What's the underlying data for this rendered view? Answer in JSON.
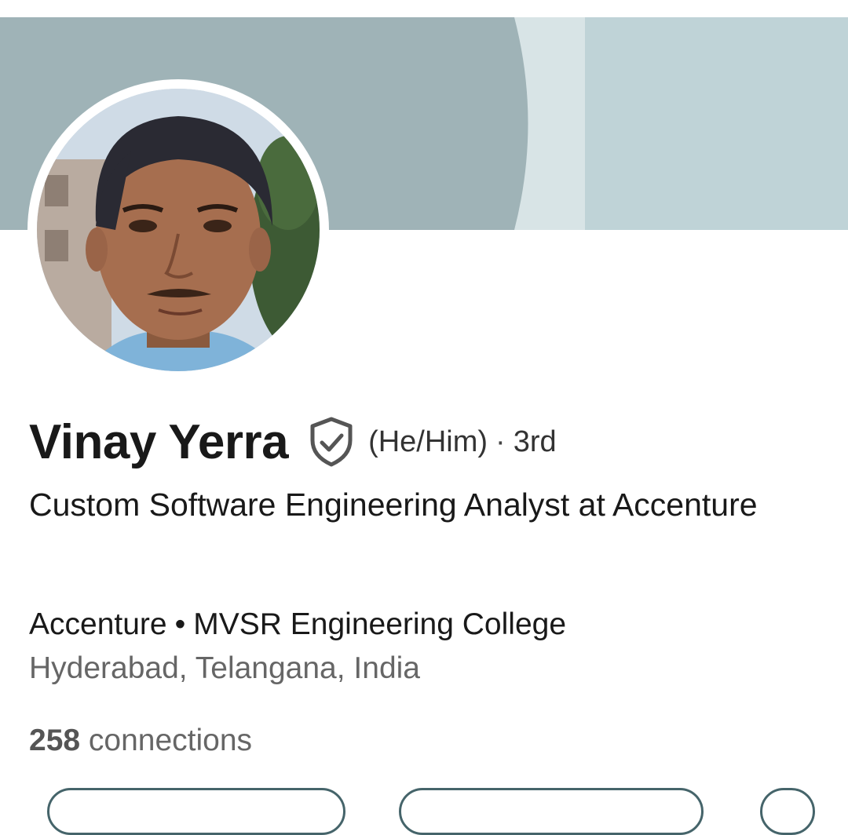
{
  "profile": {
    "name": "Vinay Yerra",
    "pronouns": "(He/Him)",
    "separator": "·",
    "degree": "3rd",
    "headline": "Custom Software Engineering Analyst at Accenture",
    "company": "Accenture",
    "bullet": "•",
    "school": "MVSR Engineering College",
    "location": "Hyderabad, Telangana, India",
    "connections_count": "258",
    "connections_label": "connections"
  },
  "icons": {
    "verified": "shield-check-icon"
  },
  "colors": {
    "cover_dark": "#9fb3b7",
    "cover_light": "#bfd3d7",
    "cover_mid": "#d8e4e6",
    "text_primary": "#191919",
    "text_secondary": "#666666",
    "button_border": "#45646a"
  }
}
